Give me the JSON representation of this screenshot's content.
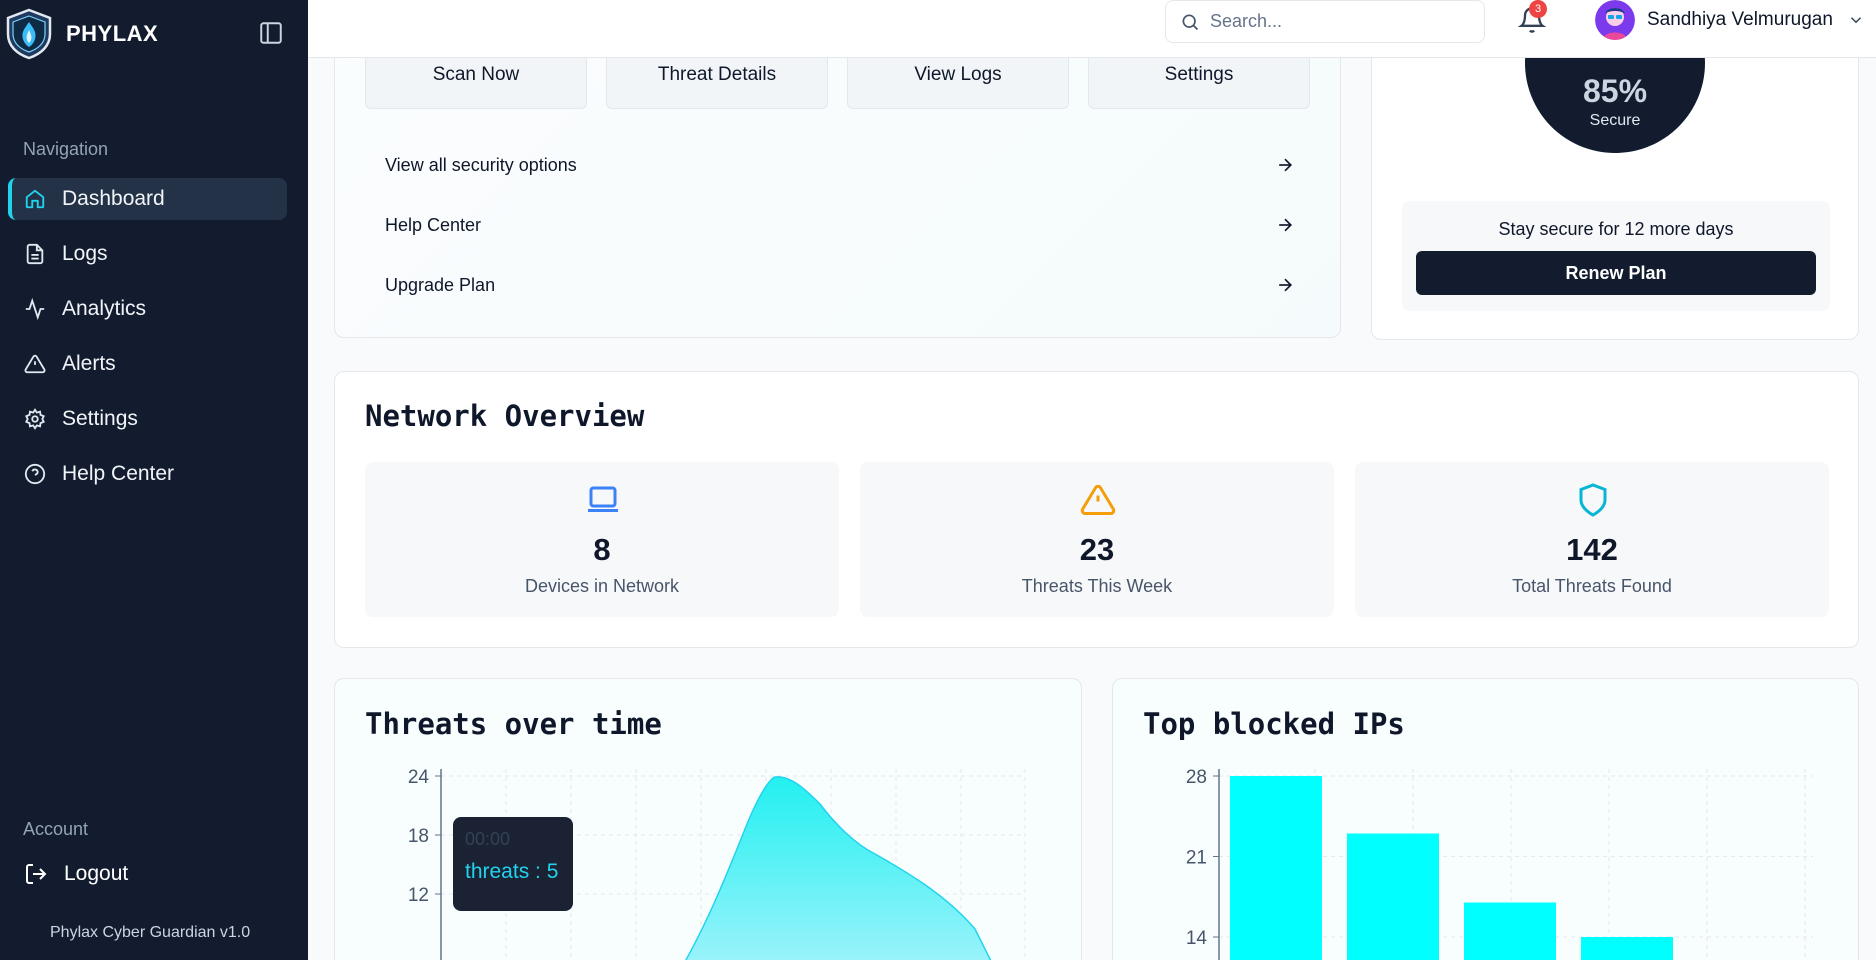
{
  "brand": {
    "name": "PHYLAX"
  },
  "sidebar": {
    "nav_heading": "Navigation",
    "items": [
      {
        "label": "Dashboard",
        "icon": "home-icon",
        "active": true
      },
      {
        "label": "Logs",
        "icon": "file-icon"
      },
      {
        "label": "Analytics",
        "icon": "activity-icon"
      },
      {
        "label": "Alerts",
        "icon": "alert-triangle-icon"
      },
      {
        "label": "Settings",
        "icon": "gear-icon"
      },
      {
        "label": "Help Center",
        "icon": "help-circle-icon"
      }
    ],
    "account_heading": "Account",
    "logout_label": "Logout",
    "version": "Phylax Cyber Guardian v1.0"
  },
  "topbar": {
    "search_placeholder": "Search...",
    "notification_count": "3",
    "user_name": "Sandhiya Velmurugan"
  },
  "quick_actions": {
    "buttons": [
      {
        "label": "Scan Now",
        "icon": "search-icon"
      },
      {
        "label": "Threat Details",
        "icon": "shield-icon"
      },
      {
        "label": "View Logs",
        "icon": "file-text-icon"
      },
      {
        "label": "Settings",
        "icon": "gear-icon"
      }
    ],
    "links": [
      {
        "label": "View all security options"
      },
      {
        "label": "Help Center"
      },
      {
        "label": "Upgrade Plan"
      }
    ]
  },
  "security": {
    "percent": "85%",
    "percent_value": 85,
    "label": "Secure",
    "renew_text": "Stay secure for 12 more days",
    "renew_button": "Renew Plan"
  },
  "network": {
    "title": "Network Overview",
    "stats": [
      {
        "value": "8",
        "label": "Devices in Network",
        "icon": "laptop-icon",
        "color": "#3b82f6"
      },
      {
        "value": "23",
        "label": "Threats This Week",
        "icon": "warning-icon",
        "color": "#f59e0b"
      },
      {
        "value": "142",
        "label": "Total Threats Found",
        "icon": "shield-icon",
        "color": "#06b6d4"
      }
    ]
  },
  "threats_chart": {
    "title": "Threats over time",
    "tooltip": {
      "label": "00:00",
      "value": "threats : 5"
    }
  },
  "ips_chart": {
    "title": "Top blocked IPs"
  },
  "chart_data": [
    {
      "type": "area",
      "title": "Threats over time",
      "y_ticks": [
        24,
        18,
        12
      ],
      "ylim": [
        12,
        24
      ],
      "color": "#22f0f0",
      "grid": true
    },
    {
      "type": "bar",
      "title": "Top blocked IPs",
      "y_ticks": [
        28,
        21,
        14
      ],
      "ylim": [
        14,
        28
      ],
      "values": [
        28,
        23,
        17,
        14
      ],
      "color": "#00ffff",
      "grid": true
    }
  ]
}
